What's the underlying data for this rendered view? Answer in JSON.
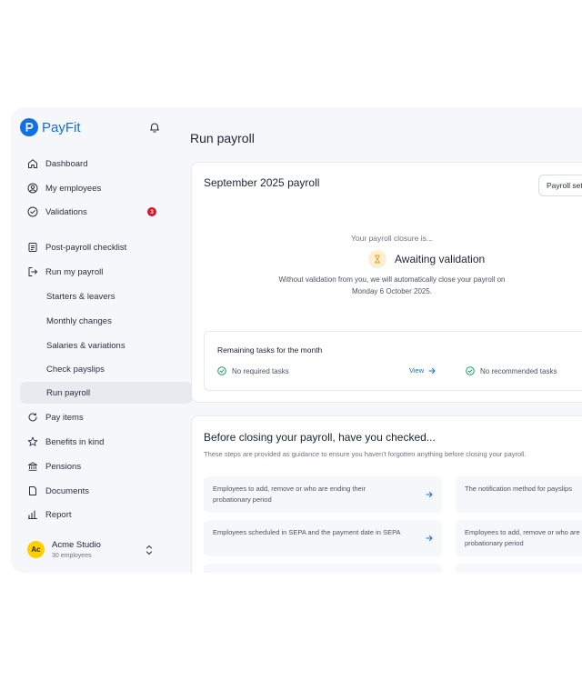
{
  "brand": {
    "name": "PayFit",
    "color": "#0f6fe5"
  },
  "sidebar": {
    "items": [
      {
        "label": "Dashboard",
        "icon": "home-icon"
      },
      {
        "label": "My employees",
        "icon": "user-circle-icon"
      },
      {
        "label": "Validations",
        "icon": "check-circle-icon",
        "badge": "3"
      },
      {
        "label": "Post-payroll checklist",
        "icon": "checklist-icon"
      },
      {
        "label": "Run my payroll",
        "icon": "exit-icon"
      },
      {
        "label": "Starters & leavers"
      },
      {
        "label": "Monthly changes"
      },
      {
        "label": "Salaries & variations"
      },
      {
        "label": "Check payslips"
      },
      {
        "label": "Run payroll",
        "active": true
      },
      {
        "label": "Pay items",
        "icon": "pay-icon"
      },
      {
        "label": "Benefits in kind",
        "icon": "star-icon"
      },
      {
        "label": "Pensions",
        "icon": "bank-icon"
      },
      {
        "label": "Documents",
        "icon": "document-icon"
      },
      {
        "label": "Report",
        "icon": "chart-icon"
      }
    ],
    "company": {
      "initials": "Ac",
      "name": "Acme Studio",
      "employees": "30 employees"
    }
  },
  "main": {
    "title": "Run payroll",
    "payroll_card": {
      "title": "September 2025 payroll",
      "settings_button": "Payroll set",
      "closure_label": "Your payroll closure is...",
      "status": "Awaiting validation",
      "description_line1": "Without validation from you, we will automatically close your payroll on",
      "description_line2": "Monday 6 October 2025.",
      "tasks": {
        "title": "Remaining tasks for the month",
        "required": "No required tasks",
        "view": "View",
        "recommended": "No recommended tasks"
      }
    },
    "checks_card": {
      "title": "Before closing your payroll, have you checked...",
      "subtitle": "These steps are provided as guidance to ensure you haven't forgotten anything before closing your payroll.",
      "items": [
        "Employees to add, remove or who are ending their probationary period",
        "The notification method for payslips",
        "Employees scheduled in SEPA and the payment date in SEPA",
        "Employees to add, remove or who are ending their probationary period"
      ]
    }
  },
  "colors": {
    "success": "#1aa05a",
    "badge": "#d4172a",
    "accent": "#0f6fe5"
  }
}
